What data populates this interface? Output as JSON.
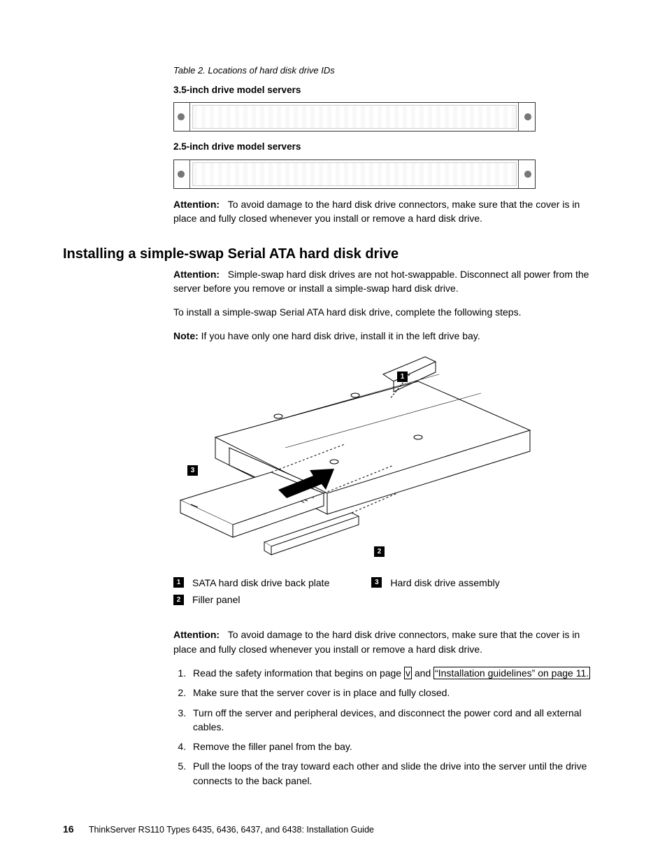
{
  "table_caption": "Table 2. Locations of hard disk drive IDs",
  "subhead_35": "3.5-inch drive model servers",
  "subhead_25": "2.5-inch drive model servers",
  "attention1": {
    "label": "Attention:",
    "text": "To avoid damage to the hard disk drive connectors, make sure that the cover is in place and fully closed whenever you install or remove a hard disk drive."
  },
  "section_title": "Installing a simple-swap Serial ATA hard disk drive",
  "attention2": {
    "label": "Attention:",
    "text": "Simple-swap hard disk drives are not hot-swappable. Disconnect all power from the server before you remove or install a simple-swap hard disk drive."
  },
  "intro": "To install a simple-swap Serial ATA hard disk drive, complete the following steps.",
  "note": {
    "label": "Note:",
    "text": "If you have only one hard disk drive, install it in the left drive bay."
  },
  "callouts": {
    "c1": "1",
    "c2": "2",
    "c3": "3"
  },
  "legend": {
    "i1": "SATA hard disk drive back plate",
    "i2": "Filler panel",
    "i3": "Hard disk drive assembly"
  },
  "attention3": {
    "label": "Attention:",
    "text": "To avoid damage to the hard disk drive connectors, make sure that the cover is in place and fully closed whenever you install or remove a hard disk drive."
  },
  "step1": {
    "prefix": "Read the safety information that begins on page ",
    "link1": "v",
    "mid": " and ",
    "link2": "“Installation guidelines” on page 11.",
    "suffix": ""
  },
  "step2": "Make sure that the server cover is in place and fully closed.",
  "step3": "Turn off the server and peripheral devices, and disconnect the power cord and all external cables.",
  "step4": "Remove the filler panel from the bay.",
  "step5": "Pull the loops of the tray toward each other and slide the drive into the server until the drive connects to the back panel.",
  "footer": {
    "page": "16",
    "doc": "ThinkServer RS110 Types 6435, 6436, 6437, and 6438: Installation Guide"
  }
}
